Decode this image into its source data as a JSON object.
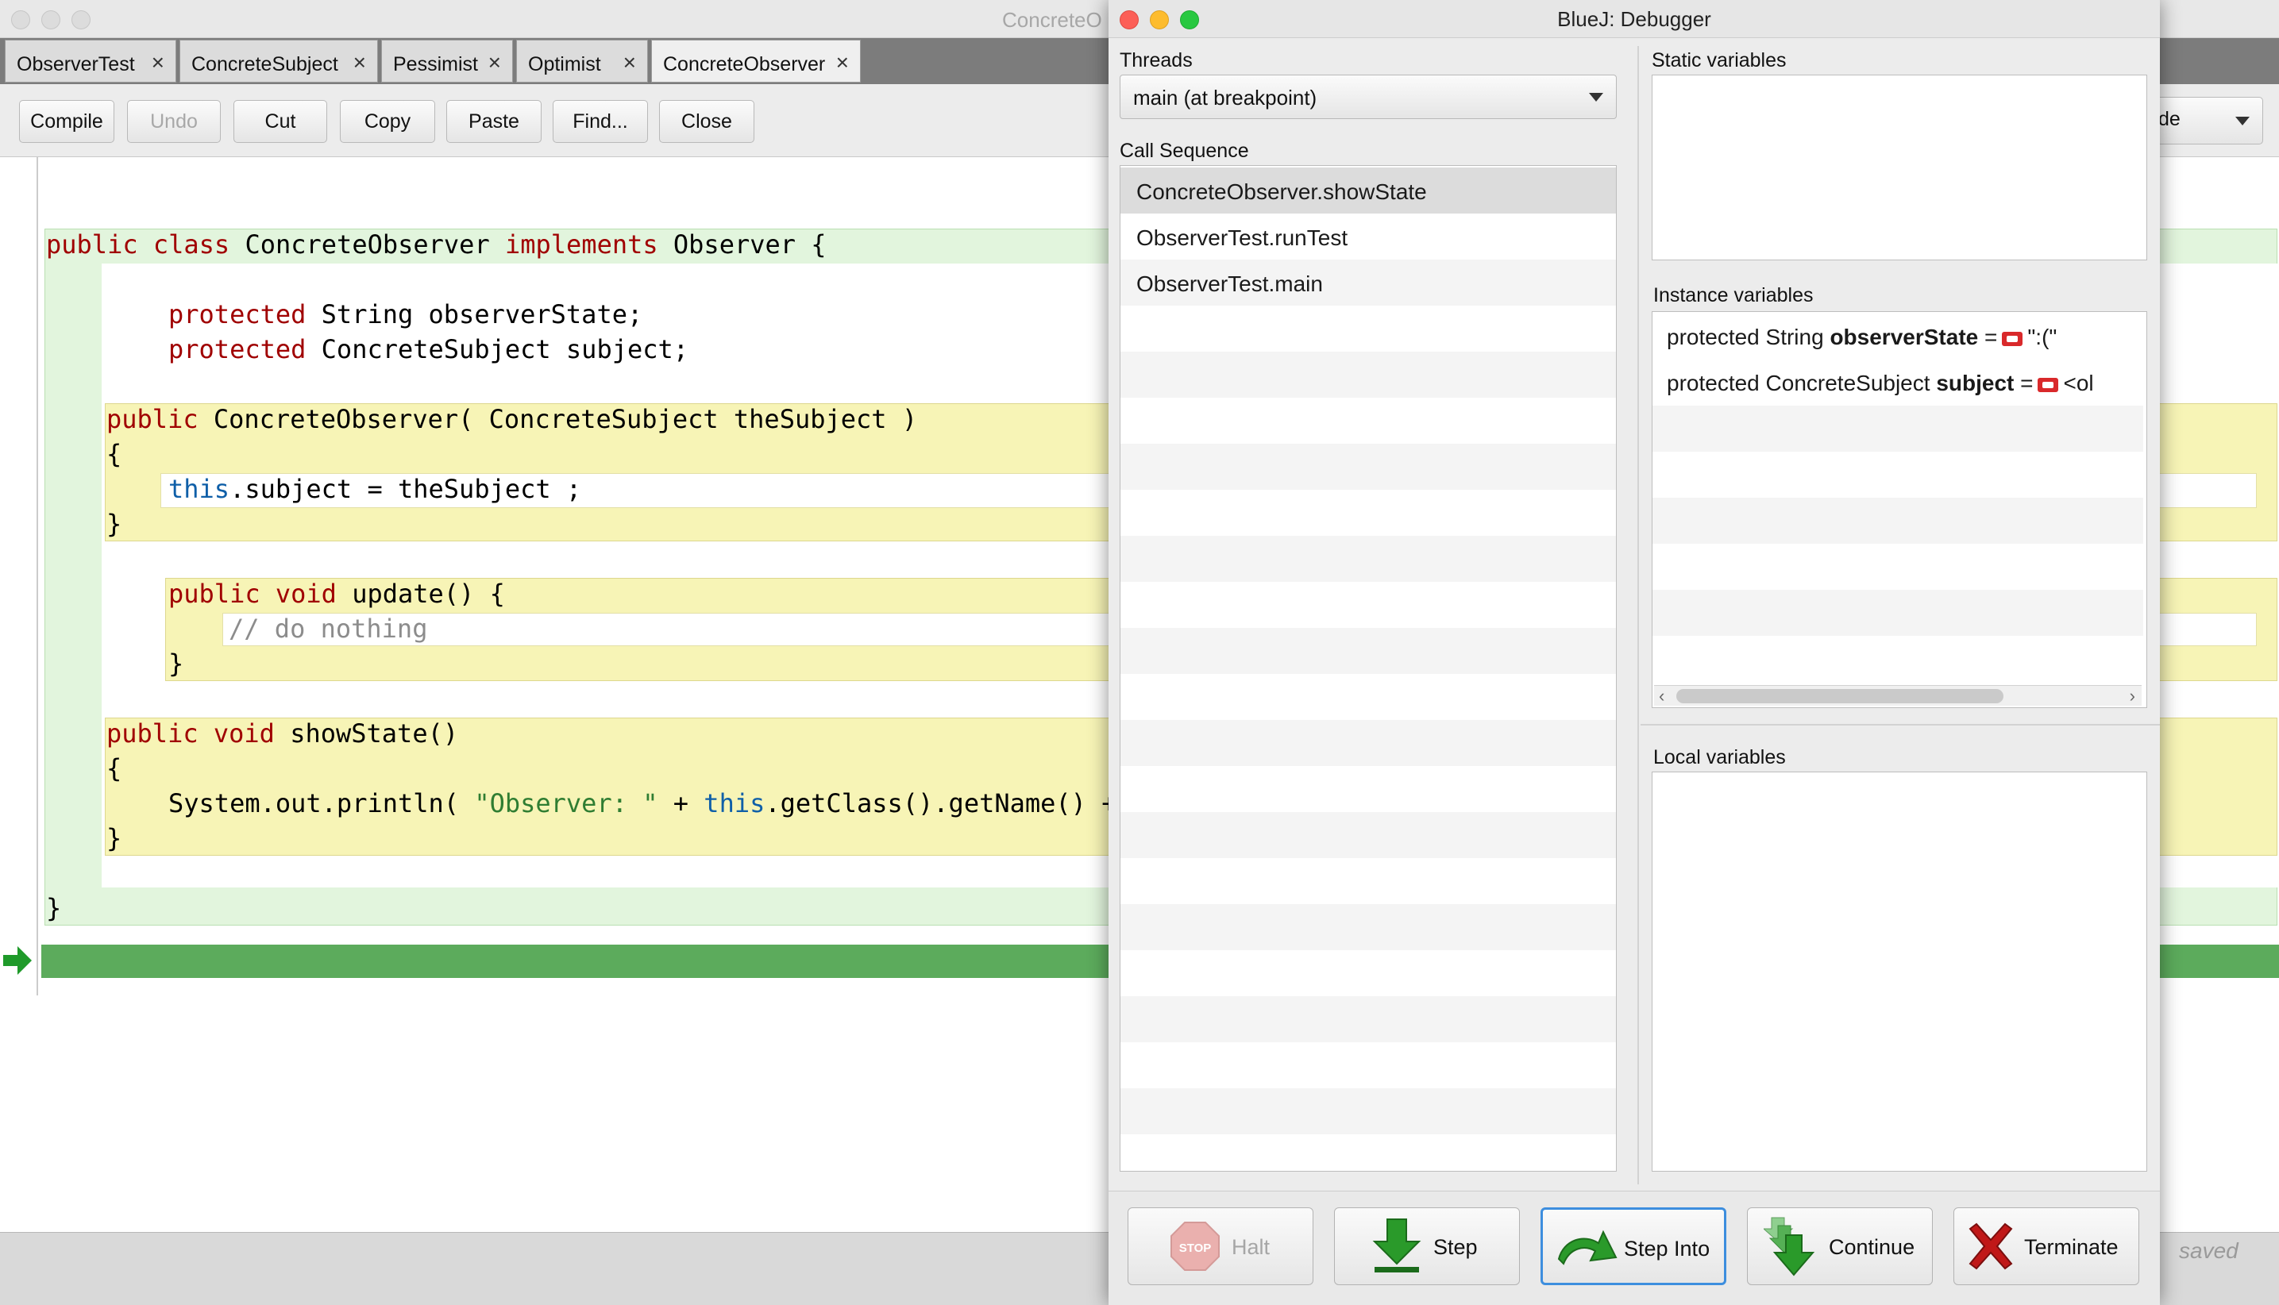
{
  "editor": {
    "title": "ConcreteO",
    "tabs": [
      {
        "label": "ObserverTest"
      },
      {
        "label": "ConcreteSubject"
      },
      {
        "label": "Pessimist"
      },
      {
        "label": "Optimist"
      },
      {
        "label": "ConcreteObserver"
      }
    ],
    "active_tab": "ConcreteObserver",
    "toolbar": {
      "compile": "Compile",
      "undo": "Undo",
      "cut": "Cut",
      "copy": "Copy",
      "paste": "Paste",
      "find": "Find...",
      "close": "Close",
      "view_select": "de"
    },
    "code": {
      "l1_kw1": "public",
      "l1_kw2": "class",
      "l1_t1": "ConcreteObserver",
      "l1_kw3": "implements",
      "l1_t2": "Observer {",
      "l2_kw": "protected",
      "l2_t": "String observerState;",
      "l3_kw": "protected",
      "l3_t": "ConcreteSubject subject;",
      "l4_kw": "public",
      "l4_t": "ConcreteObserver( ConcreteSubject theSubject )",
      "l5": "{",
      "l6_kw": "this",
      "l6_t": ".subject = theSubject ;",
      "l7": "}",
      "l8_kw1": "public",
      "l8_kw2": "void",
      "l8_t": "update() {",
      "l9": "// do nothing",
      "l10": "}",
      "l11_kw1": "public",
      "l11_kw2": "void",
      "l11_t": "showState()",
      "l12": "{",
      "l13_t1": "System.out.println( ",
      "l13_str": "\"Observer: \"",
      "l13_t2": " + ",
      "l13_kw": "this",
      "l13_t3": ".getClass().getName() +",
      "l14": "}",
      "l15": "}"
    },
    "status": "saved"
  },
  "debugger": {
    "title": "BlueJ:  Debugger",
    "threads_label": "Threads",
    "threads_value": "main (at breakpoint)",
    "call_sequence_label": "Call Sequence",
    "call_sequence": [
      "ConcreteObserver.showState",
      "ObserverTest.runTest",
      "ObserverTest.main"
    ],
    "static_label": "Static variables",
    "instance_label": "Instance variables",
    "instance_vars": [
      {
        "prefix": "protected String",
        "name": "observerState",
        "eq": "=",
        "value": "\":(\""
      },
      {
        "prefix": "protected ConcreteSubject",
        "name": "subject",
        "eq": "=",
        "value": "<ol"
      }
    ],
    "local_label": "Local variables",
    "buttons": {
      "halt": "Halt",
      "stop_sign": "STOP",
      "step": "Step",
      "step_into": "Step Into",
      "continue": "Continue",
      "terminate": "Terminate"
    }
  },
  "colors": {
    "class_scope": "#e2f5dd",
    "method_scope": "#f7f4b6",
    "exec_line": "#5cab5c",
    "keyword": "#a00000",
    "this_keyword": "#0f5fa8",
    "string": "#2f7d32"
  }
}
